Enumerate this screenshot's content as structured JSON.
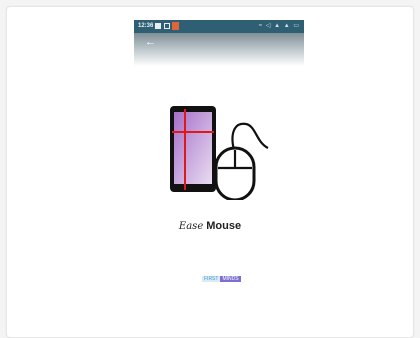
{
  "status_bar": {
    "time": "12:36",
    "right_text": "≈ ◁ ▲ ▲ ▭"
  },
  "appbar": {
    "back_glyph": "←"
  },
  "app": {
    "name_part1": "Ease",
    "name_part2": "Mouse"
  },
  "brand": {
    "part1": "FIRST",
    "part2": "MINDS"
  },
  "colors": {
    "statusbar": "#2f5f73",
    "accent_red": "#e01818",
    "phone_purple": "#8d57b2"
  }
}
